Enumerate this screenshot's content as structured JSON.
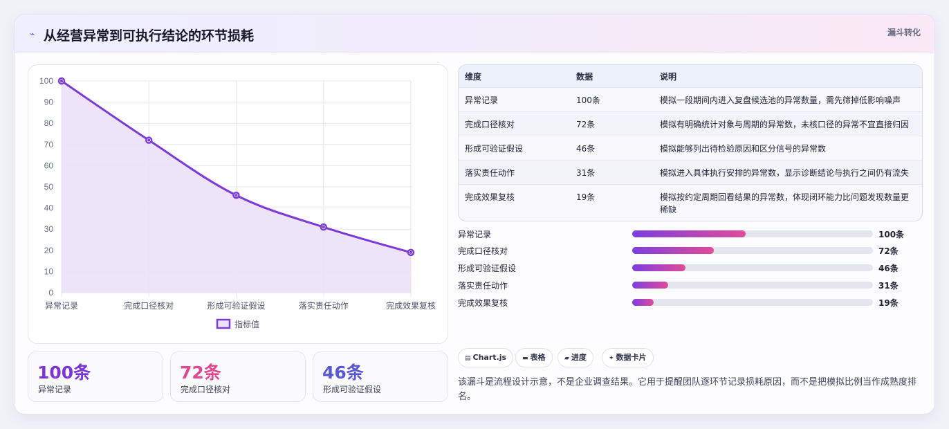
{
  "header": {
    "icon": "chart-lightning-icon",
    "icon_glyph": "⌁",
    "title": "从经营异常到可执行结论的环节损耗",
    "tag": "漏斗转化"
  },
  "chart_data": {
    "type": "area",
    "categories": [
      "异常记录",
      "完成口径核对",
      "形成可验证假设",
      "落实责任动作",
      "完成效果复核"
    ],
    "series": [
      {
        "name": "指标值",
        "values": [
          100,
          72,
          46,
          31,
          19
        ]
      }
    ],
    "ylim": [
      0,
      100
    ],
    "yticks": [
      0,
      10,
      20,
      30,
      40,
      50,
      60,
      70,
      80,
      90,
      100
    ],
    "grid": true,
    "legend": "bottom",
    "colors": {
      "line": "#7c3ad8",
      "fill": "#ebe1f8",
      "grid": "#e6e6ef"
    }
  },
  "kpis": [
    {
      "value": "100条",
      "label": "异常记录",
      "color": "#7b35d8"
    },
    {
      "value": "72条",
      "label": "完成口径核对",
      "color": "#e0488f"
    },
    {
      "value": "46条",
      "label": "形成可验证假设",
      "color": "#5a57d4"
    }
  ],
  "table": {
    "headers": [
      "维度",
      "数据",
      "说明"
    ],
    "rows": [
      [
        "异常记录",
        "100条",
        "模拟一段期间内进入复盘候选池的异常数量，需先筛掉低影响噪声"
      ],
      [
        "完成口径核对",
        "72条",
        "模拟有明确统计对象与周期的异常数，未核口径的异常不宜直接归因"
      ],
      [
        "形成可验证假设",
        "46条",
        "模拟能够列出待检验原因和区分信号的异常数"
      ],
      [
        "落实责任动作",
        "31条",
        "模拟进入具体执行安排的异常数，显示诊断结论与执行之间仍有流失"
      ],
      [
        "完成效果复核",
        "19条",
        "模拟按约定周期回看结果的异常数，体现闭环能力比问题发现数量更稀缺"
      ]
    ]
  },
  "progress": [
    {
      "label": "异常记录",
      "value": "100条",
      "fraction": 0.47
    },
    {
      "label": "完成口径核对",
      "value": "72条",
      "fraction": 0.34
    },
    {
      "label": "形成可验证假设",
      "value": "46条",
      "fraction": 0.22
    },
    {
      "label": "落实责任动作",
      "value": "31条",
      "fraction": 0.15
    },
    {
      "label": "完成效果复核",
      "value": "19条",
      "fraction": 0.09
    }
  ],
  "chips": [
    {
      "icon": "chart-icon",
      "glyph": "▤",
      "label": "Chart.js"
    },
    {
      "icon": "table-icon",
      "glyph": "▬",
      "label": "表格"
    },
    {
      "icon": "progress-icon",
      "glyph": "▰",
      "label": "进度"
    },
    {
      "icon": "sparkle-icon",
      "glyph": "✦",
      "label": "数据卡片"
    }
  ],
  "footnote": "该漏斗是流程设计示意，不是企业调查结果。它用于提醒团队逐环节记录损耗原因，而不是把模拟比例当作成熟度排名。"
}
